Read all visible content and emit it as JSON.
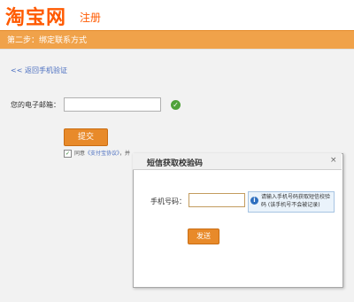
{
  "header": {
    "logo_text": "淘宝网",
    "logo_sub": "注册"
  },
  "step_bar": {
    "text": "第二步：绑定联系方式"
  },
  "form": {
    "back_link": "<< 返回手机验证",
    "email_label": "您的电子邮箱：",
    "email_value": "",
    "submit_label": "提交",
    "agree_prefix": "同意",
    "agree_link": "《支付宝协议》",
    "agree_suffix": "，并"
  },
  "dialog": {
    "title": "短信获取校验码",
    "close": "×",
    "phone_label": "手机号码：",
    "phone_value": "",
    "hint_icon": "i",
    "hint": "请输入手机号码获取短信校验码 (该手机号不会被记录)",
    "send_label": "发送"
  },
  "icons": {
    "valid": "check-circle-icon",
    "info": "info-icon",
    "close": "close-icon"
  },
  "colors": {
    "brand": "#ff5a00",
    "step_bar": "#f0a24a",
    "button": "#e88a2a",
    "valid": "#4fa23a",
    "info": "#2e6fbf"
  }
}
